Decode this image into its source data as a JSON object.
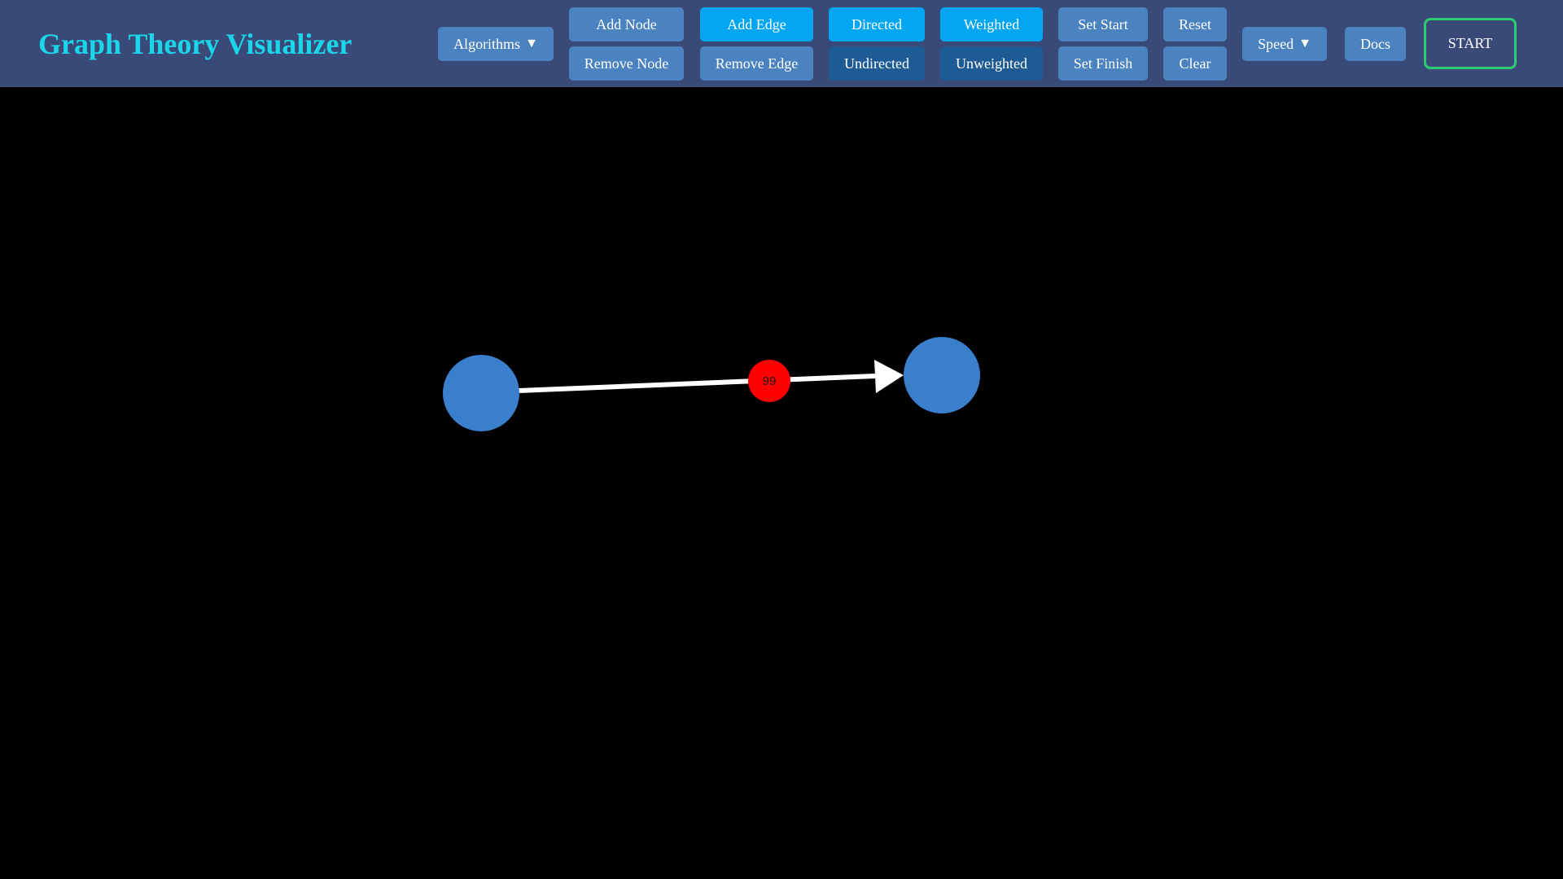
{
  "header": {
    "title": "Graph Theory Visualizer"
  },
  "toolbar": {
    "algorithms_label": "Algorithms",
    "add_node_label": "Add Node",
    "remove_node_label": "Remove Node",
    "add_edge_label": "Add Edge",
    "remove_edge_label": "Remove Edge",
    "directed_label": "Directed",
    "undirected_label": "Undirected",
    "weighted_label": "Weighted",
    "unweighted_label": "Unweighted",
    "set_start_label": "Set Start",
    "set_finish_label": "Set Finish",
    "reset_label": "Reset",
    "clear_label": "Clear",
    "speed_label": "Speed",
    "docs_label": "Docs",
    "start_label": "START",
    "caret_icon": "▼"
  },
  "graph": {
    "mode": {
      "directed": true,
      "weighted": true
    },
    "edges": [
      {
        "weight": "99"
      }
    ]
  },
  "colors": {
    "accent_title": "#1ad6e8",
    "navbar": "#3a4a78",
    "button": "#4a83c0",
    "button_active": "#03a6f2",
    "button_inactive": "#1e5a94",
    "start_border": "#2ecc71",
    "node": "#3a7fcc",
    "edge": "#ffffff",
    "weight_badge": "#ff0000"
  }
}
